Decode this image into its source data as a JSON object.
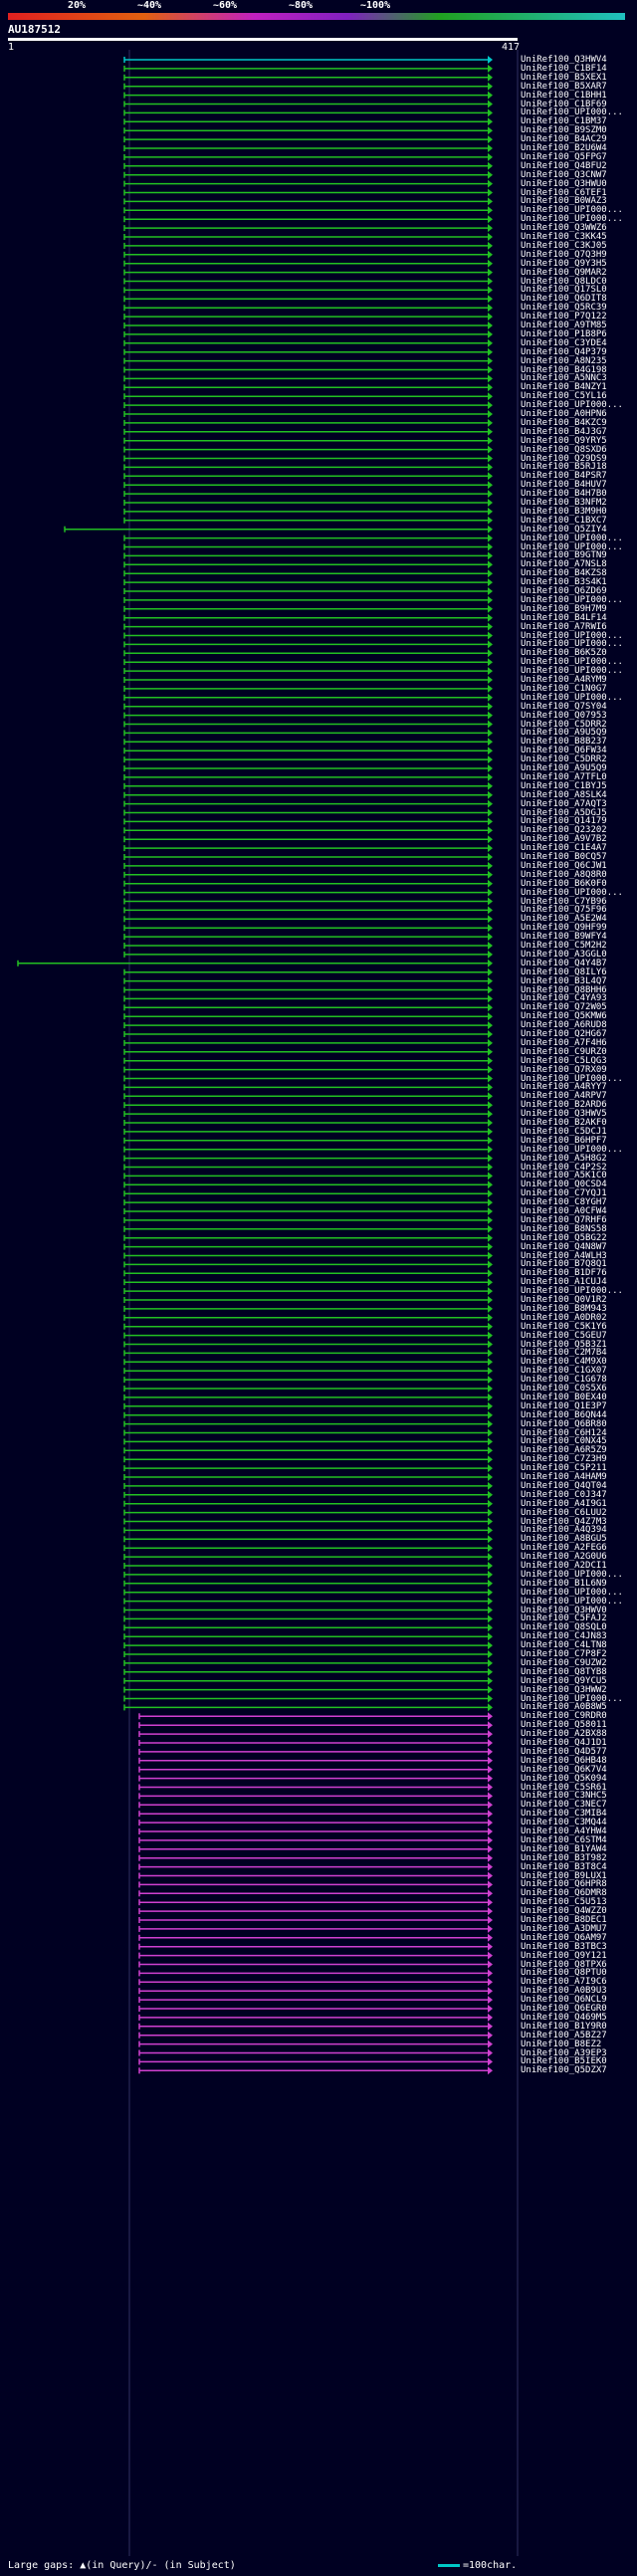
{
  "header": {
    "pct_labels": [
      "20%",
      "~40%",
      "~60%",
      "~80%",
      "~100%"
    ],
    "query_name": "AU187512",
    "scale_start": "1",
    "scale_end": "417"
  },
  "footer": {
    "gaps_label": "Large gaps: ▲(in Query)/- (in Subject)",
    "legend_label": "=100char."
  },
  "colors": {
    "background": "#000022",
    "green_hit": "#22c022",
    "magenta_hit": "#d040d0",
    "cyan_hit": "#00c8c8"
  },
  "hits": [
    "UniRef100_Q3HWV4",
    "UniRef100_C1BF14",
    "UniRef100_B5XEX1",
    "UniRef100_B5XAR7",
    "UniRef100_C1BHH1",
    "UniRef100_C1BF69",
    "UniRef100_UPI000...",
    "UniRef100_C1BM37",
    "UniRef100_B9SZM0",
    "UniRef100_B4AC29",
    "UniRef100_B2U6W4",
    "UniRef100_Q5FPG7",
    "UniRef100_Q4BFU2",
    "UniRef100_Q3CNW7",
    "UniRef100_Q3HWU0",
    "UniRef100_C6TEF1",
    "UniRef100_B0WAZ3",
    "UniRef100_UPI000...",
    "UniRef100_UPI000...",
    "UniRef100_Q3WWZ6",
    "UniRef100_C3KK45",
    "UniRef100_C3KJ05",
    "UniRef100_Q7Q3H9",
    "UniRef100_Q9Y3H5",
    "UniRef100_Q9MAR2",
    "UniRef100_Q8LDC0",
    "UniRef100_Q17SL0",
    "UniRef100_Q6DIT8",
    "UniRef100_Q5RC39",
    "UniRef100_P7Q122",
    "UniRef100_A9TM85",
    "UniRef100_P1B8P6",
    "UniRef100_C3YDE4",
    "UniRef100_Q4P379",
    "UniRef100_A8N235",
    "UniRef100_B4G198",
    "UniRef100_A5NNC3",
    "UniRef100_B4NZY1",
    "UniRef100_C5YL16",
    "UniRef100_UPI000...",
    "UniRef100_A0HPN6",
    "UniRef100_B4KZC9",
    "UniRef100_B4J3G7",
    "UniRef100_Q9YRY5",
    "UniRef100_Q8SXD6",
    "UniRef100_Q29DS9",
    "UniRef100_B5RJ18",
    "UniRef100_B4PSR7",
    "UniRef100_B4HUV7",
    "UniRef100_B4H7B0",
    "UniRef100_B3NFM2",
    "UniRef100_B3M9H0",
    "UniRef100_C1BXC7",
    "UniRef100_Q5ZIY4",
    "UniRef100_UPI000...",
    "UniRef100_UPI000...",
    "UniRef100_B9GTN9",
    "UniRef100_A7NSL8",
    "UniRef100_B4KZS8",
    "UniRef100_B3S4K1",
    "UniRef100_Q6ZD69",
    "UniRef100_UPI000...",
    "UniRef100_B9H7M9",
    "UniRef100_B4LF14",
    "UniRef100_A7RWI6",
    "UniRef100_UPI000...",
    "UniRef100_UPI000...",
    "UniRef100_B6K5Z0",
    "UniRef100_UPI000...",
    "UniRef100_UPI000...",
    "UniRef100_A4RYM9",
    "UniRef100_C1N0G7",
    "UniRef100_UPI000...",
    "UniRef100_Q7SY04",
    "UniRef100_Q07953",
    "UniRef100_C5DRR2",
    "UniRef100_A9U5Q9",
    "UniRef100_B8B237",
    "UniRef100_Q6FW34",
    "UniRef100_C5DRR2",
    "UniRef100_A9U5Q9",
    "UniRef100_A7TFL0",
    "UniRef100_C1BYJ5",
    "UniRef100_A8SLK4",
    "UniRef100_A7AQT3",
    "UniRef100_A5DGJ5",
    "UniRef100_Q14179",
    "UniRef100_Q23202",
    "UniRef100_A9V7B2",
    "UniRef100_C1E4A7",
    "UniRef100_B0CQ57",
    "UniRef100_Q6CJW1",
    "UniRef100_A8Q8R0",
    "UniRef100_B6K0F0",
    "UniRef100_UPI000...",
    "UniRef100_C7YB96",
    "UniRef100_Q75F96",
    "UniRef100_A5E2W4",
    "UniRef100_Q9HF99",
    "UniRef100_B9WFY4",
    "UniRef100_C5M2H2",
    "UniRef100_A3GGL0",
    "UniRef100_Q4Y4B7",
    "UniRef100_Q8ILY6",
    "UniRef100_B3L4Q7",
    "UniRef100_Q8BHH6",
    "UniRef100_C4YA93",
    "UniRef100_Q72W05",
    "UniRef100_Q5KMW6",
    "UniRef100_A6RUD8",
    "UniRef100_Q2HG67",
    "UniRef100_A7F4H6",
    "UniRef100_C9URZ0",
    "UniRef100_C5LQG3",
    "UniRef100_Q7RX09",
    "UniRef100_UPI000...",
    "UniRef100_A4RYY7",
    "UniRef100_A4RPV7",
    "UniRef100_B2ARD6",
    "UniRef100_Q3HWV5",
    "UniRef100_B2AKF0",
    "UniRef100_C5DCJ1",
    "UniRef100_B6HPF7",
    "UniRef100_UPI000...",
    "UniRef100_A5H8G2",
    "UniRef100_C4P2S2",
    "UniRef100_A5K1C0",
    "UniRef100_Q0CSD4",
    "UniRef100_C7YQJ1",
    "UniRef100_C8YGH7",
    "UniRef100_A0CFW4",
    "UniRef100_Q7RHF6",
    "UniRef100_B8NS58",
    "UniRef100_Q5BG22",
    "UniRef100_Q4N8W7",
    "UniRef100_A4WLH3",
    "UniRef100_B7Q8Q1",
    "UniRef100_B1DF76",
    "UniRef100_A1CUJ4",
    "UniRef100_UPI000...",
    "UniRef100_Q0V1R2",
    "UniRef100_B8M943",
    "UniRef100_A0DR02",
    "UniRef100_C5K1Y6",
    "UniRef100_C5GEU7",
    "UniRef100_Q5B3Z1",
    "UniRef100_C2M7B4",
    "UniRef100_C4M9X0",
    "UniRef100_C1GX07",
    "UniRef100_C1G678",
    "UniRef100_C0S5X6",
    "UniRef100_B0EX40",
    "UniRef100_Q1E3P7",
    "UniRef100_B6QN44",
    "UniRef100_Q6BR80",
    "UniRef100_C6H124",
    "UniRef100_C0NX45",
    "UniRef100_A6R5Z9",
    "UniRef100_C7Z3H9",
    "UniRef100_C5P211",
    "UniRef100_A4HAM9",
    "UniRef100_Q4QT04",
    "UniRef100_C0J347",
    "UniRef100_A4I9G1",
    "UniRef100_C6LUU2",
    "UniRef100_Q4Z7M3",
    "UniRef100_A4Q394",
    "UniRef100_A8BGU5",
    "UniRef100_A2FEG6",
    "UniRef100_A2G0U6",
    "UniRef100_A2DCI1",
    "UniRef100_UPI000...",
    "UniRef100_B1L6N9",
    "UniRef100_UPI000...",
    "UniRef100_UPI000...",
    "UniRef100_Q3HWV0",
    "UniRef100_C5FAJ2",
    "UniRef100_Q8SQL0",
    "UniRef100_C4JN83",
    "UniRef100_C4LTN8",
    "UniRef100_C7P8F2",
    "UniRef100_C9UZW2",
    "UniRef100_Q8TYB8",
    "UniRef100_Q9YCU5",
    "UniRef100_Q3HWW2",
    "UniRef100_UPI000...",
    "UniRef100_A0B8W5",
    "UniRef100_C9RDR0",
    "UniRef100_Q58011",
    "UniRef100_A2BX88",
    "UniRef100_Q4J1D1",
    "UniRef100_Q4D577",
    "UniRef100_Q6HB48",
    "UniRef100_Q6K7V4",
    "UniRef100_Q5K094",
    "UniRef100_C5SR61",
    "UniRef100_C3NHC5",
    "UniRef100_C3NEC7",
    "UniRef100_C3MIB4",
    "UniRef100_C3MQ44",
    "UniRef100_A4YHW4",
    "UniRef100_C6STM4",
    "UniRef100_B1YAW4",
    "UniRef100_B3T982",
    "UniRef100_B3T8C4",
    "UniRef100_B9LUX1",
    "UniRef100_Q6HPR8",
    "UniRef100_Q6DMR8",
    "UniRef100_C5U513",
    "UniRef100_Q4WZZ0",
    "UniRef100_B8DEC1",
    "UniRef100_A3DMU7",
    "UniRef100_Q6AM97",
    "UniRef100_B3TBC3",
    "UniRef100_Q9Y121",
    "UniRef100_Q8TPX6",
    "UniRef100_Q8PTU0",
    "UniRef100_A7I9C6",
    "UniRef100_A0B9U3",
    "UniRef100_Q6NCL9",
    "UniRef100_Q6EGR0",
    "UniRef100_Q469M5",
    "UniRef100_B1Y9R0",
    "UniRef100_A5BZ27",
    "UniRef100_B8EZ2",
    "UniRef100_A39EP3",
    "UniRef100_B5IEK0",
    "UniRef100_Q5DZX7"
  ]
}
